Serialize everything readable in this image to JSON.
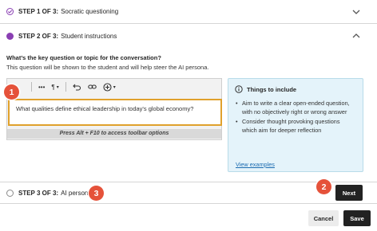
{
  "steps": [
    {
      "prefix": "STEP 1 OF 3:",
      "title": "Socratic questioning",
      "state": "completed",
      "chevron": "chevron-down-icon"
    },
    {
      "prefix": "STEP 2 OF 3:",
      "title": "Student instructions",
      "state": "active",
      "chevron": "chevron-up-icon"
    },
    {
      "prefix": "STEP 3 OF 3:",
      "title": "AI persona",
      "state": "pending"
    }
  ],
  "question": {
    "label": "What’s the key question or topic for the conversation?",
    "help": "This question will be shown to the student and will help steer the AI persona."
  },
  "editor": {
    "toolbar": {
      "more": "•••",
      "paragraph": "¶",
      "caret": "▾"
    },
    "value": "What qualities define ethical leadership in today's global economy?",
    "alt_hint": "Press Alt + F10 to access toolbar options"
  },
  "info": {
    "title": "Things to include",
    "items": [
      "Aim to write a clear open-ended question, with no objectively right or wrong answer",
      "Consider thought provoking questions which aim for deeper reflection"
    ],
    "link": "View examples"
  },
  "badges": {
    "one": "1",
    "two": "2",
    "three": "3"
  },
  "buttons": {
    "next": "Next",
    "cancel": "Cancel",
    "save": "Save"
  },
  "colors": {
    "accent": "#8a3fb3",
    "badge": "#e5523a",
    "focus_border": "#e0a12c",
    "info_bg": "#e4f3fa",
    "link": "#1b6bb0"
  }
}
